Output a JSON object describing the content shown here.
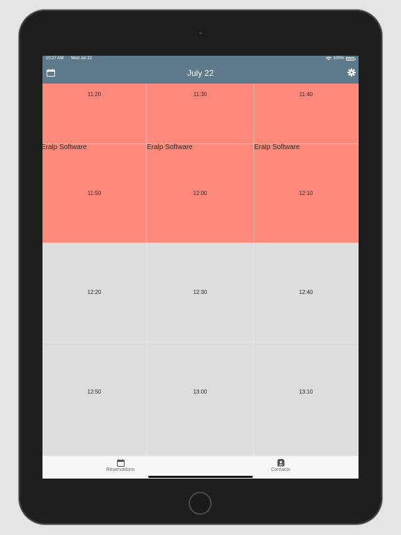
{
  "status_bar": {
    "time": "10:27 AM",
    "date": "Wed Jul 22",
    "battery": "100%"
  },
  "nav": {
    "title": "July 22",
    "left_icon": "calendar-icon",
    "right_icon": "gear-icon"
  },
  "colors": {
    "nav_background": "#5f7a8a",
    "booked_slot": "#ff897c",
    "free_slot": "#dedcde"
  },
  "slots": [
    [
      "11:20",
      "11:30",
      "11:40"
    ],
    [
      "11:50",
      "12:00",
      "12:10"
    ],
    [
      "12:20",
      "12:30",
      "12:40"
    ],
    [
      "12:50",
      "13:00",
      "13:10"
    ]
  ],
  "booking_labels": [
    "Eralp Software",
    "Eralp Software",
    "Eralp Software"
  ],
  "tabs": [
    {
      "label": "Reservations",
      "icon": "calendar-icon"
    },
    {
      "label": "Contacts",
      "icon": "contacts-icon"
    }
  ]
}
